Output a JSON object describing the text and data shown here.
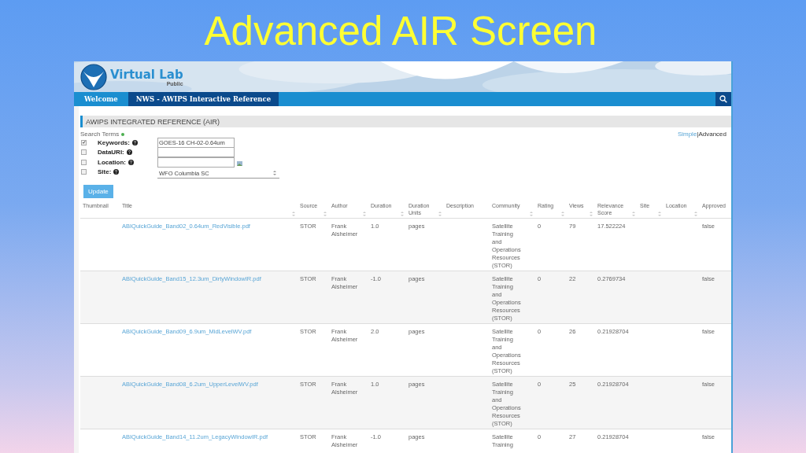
{
  "slide_title": "Advanced AIR Screen",
  "site": {
    "name": "Virtual Lab",
    "subtitle": "Public"
  },
  "nav_tabs": [
    {
      "label": "Welcome",
      "selected": false
    },
    {
      "label": "NWS - AWIPS Interactive Reference",
      "selected": true
    }
  ],
  "section_title": "AWIPS INTEGRATED REFERENCE (AIR)",
  "search": {
    "heading": "Search Terms",
    "separator": "|",
    "modes": [
      {
        "label": "Simple",
        "selected": false
      },
      {
        "label": "Advanced",
        "selected": true
      }
    ],
    "fields": [
      {
        "kind": "text",
        "label": "Keywords:",
        "checked": true,
        "value": "GOES-16 CH-02-0.64um"
      },
      {
        "kind": "text",
        "label": "DataURI:",
        "checked": false
      },
      {
        "kind": "map",
        "label": "Location:",
        "checked": false
      },
      {
        "kind": "select",
        "label": "Site:",
        "checked": false,
        "value": "WFO Columbia SC"
      }
    ],
    "button": "Update"
  },
  "table": {
    "columns": [
      {
        "label": "Thumbnail",
        "sortable": false
      },
      {
        "label": "Title",
        "sortable": true
      },
      {
        "label": "Source",
        "sortable": true
      },
      {
        "label": "Author",
        "sortable": true
      },
      {
        "label": "Duration",
        "sortable": true
      },
      {
        "label": "Duration Units",
        "sortable": true
      },
      {
        "label": "Description",
        "sortable": false
      },
      {
        "label": "Community",
        "sortable": true
      },
      {
        "label": "Rating",
        "sortable": true
      },
      {
        "label": "Views",
        "sortable": true
      },
      {
        "label": "Relevance Score",
        "sortable": true
      },
      {
        "label": "Site",
        "sortable": true
      },
      {
        "label": "Location",
        "sortable": true
      },
      {
        "label": "Approved",
        "sortable": false
      }
    ],
    "rows": [
      {
        "title": "ABIQuickGuide_Band02_0.64um_RedVisible.pdf",
        "source": "STOR",
        "author": "Frank Alsheimer",
        "duration": "1.0",
        "duration_units": "pages",
        "community": "Satellite Training and Operations Resources (STOR)",
        "rating": "0",
        "views": "79",
        "relevance_score": "17.522224",
        "approved": "false"
      },
      {
        "title": "ABIQuickGuide_Band15_12.3um_DirtyWindowIR.pdf",
        "source": "STOR",
        "author": "Frank Alsheimer",
        "duration": "-1.0",
        "duration_units": "pages",
        "community": "Satellite Training and Operations Resources (STOR)",
        "rating": "0",
        "views": "22",
        "relevance_score": "0.2769734",
        "approved": "false"
      },
      {
        "title": "ABIQuickGuide_Band09_6.9um_MidLevelWV.pdf",
        "source": "STOR",
        "author": "Frank Alsheimer",
        "duration": "2.0",
        "duration_units": "pages",
        "community": "Satellite Training and Operations Resources (STOR)",
        "rating": "0",
        "views": "26",
        "relevance_score": "0.21928704",
        "approved": "false"
      },
      {
        "title": "ABIQuickGuide_Band08_6.2um_UpperLevelWV.pdf",
        "source": "STOR",
        "author": "Frank Alsheimer",
        "duration": "1.0",
        "duration_units": "pages",
        "community": "Satellite Training and Operations Resources (STOR)",
        "rating": "0",
        "views": "25",
        "relevance_score": "0.21928704",
        "approved": "false"
      },
      {
        "title": "ABIQuickGuide_Band14_11.2um_LegacyWindowIR.pdf",
        "source": "STOR",
        "author": "Frank Alsheimer",
        "duration": "-1.0",
        "duration_units": "pages",
        "community": "Satellite Training",
        "rating": "0",
        "views": "27",
        "relevance_score": "0.21928704",
        "approved": "false"
      }
    ]
  }
}
